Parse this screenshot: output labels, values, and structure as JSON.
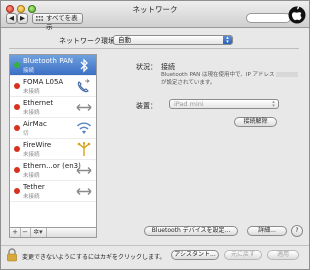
{
  "window": {
    "title": "ネットワーク"
  },
  "toolbar": {
    "back_label": "◀",
    "forward_label": "▶",
    "show_all_label": "すべてを表示"
  },
  "network_location": {
    "label": "ネットワーク環境：",
    "value": "自動"
  },
  "services": [
    {
      "name": "Bluetooth PAN",
      "status": "接続",
      "dot_color": "#35b23a",
      "icon": "bluetooth-icon",
      "selected": true
    },
    {
      "name": "FOMA L05A",
      "status": "未接続",
      "dot_color": "#d8321e",
      "icon": "phone-handset-icon",
      "selected": false
    },
    {
      "name": "Ethernet",
      "status": "未接続",
      "dot_color": "#d8321e",
      "icon": "ethernet-arrows-icon",
      "selected": false
    },
    {
      "name": "AirMac",
      "status": "切",
      "dot_color": "#d8321e",
      "icon": "wifi-icon",
      "selected": false
    },
    {
      "name": "FireWire",
      "status": "未接続",
      "dot_color": "#d8321e",
      "icon": "firewire-icon",
      "selected": false
    },
    {
      "name": "Ethern...or (en3)",
      "status": "未接続",
      "dot_color": "#d8321e",
      "icon": "ethernet-arrows-icon",
      "selected": false
    },
    {
      "name": "Tether",
      "status": "未接続",
      "dot_color": "#d8321e",
      "icon": "ethernet-arrows-icon",
      "selected": false
    }
  ],
  "sidebar_toolbar": {
    "add": "+",
    "remove": "−",
    "action": "✲▾"
  },
  "detail": {
    "status_label": "状況：",
    "status_value": "接続",
    "status_desc_line1": "Bluetooth PAN は現在使用中で、IP アドレス",
    "status_desc_line2": "が設定されています。",
    "device_label": "装置：",
    "device_value": "iPad mini",
    "disconnect_button": "接続解除"
  },
  "buttons": {
    "bluetooth_setup": "Bluetooth デバイスを設定...",
    "advanced": "詳細...",
    "help": "?",
    "assistant": "アシスタント...",
    "revert": "元に戻す",
    "apply": "適用"
  },
  "lock_text": "変更できないようにするにはカギをクリックします。"
}
